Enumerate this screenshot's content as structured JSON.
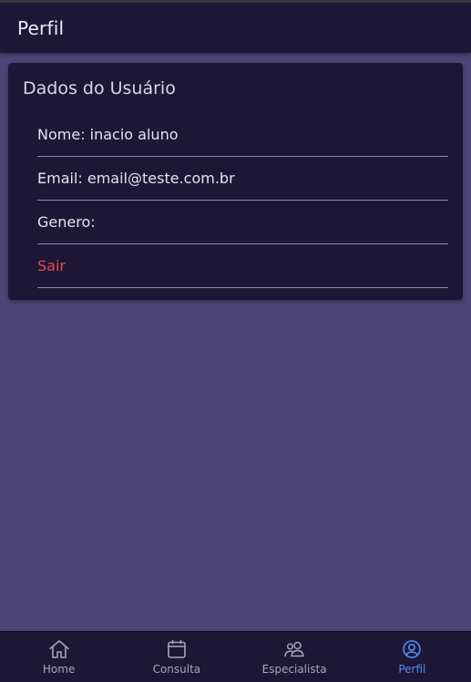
{
  "header": {
    "title": "Perfil"
  },
  "card": {
    "title": "Dados do Usuário",
    "items": [
      {
        "label": "Nome: inacio aluno"
      },
      {
        "label": "Email: email@teste.com.br"
      },
      {
        "label": "Genero:"
      },
      {
        "label": "Sair"
      }
    ]
  },
  "tabs": [
    {
      "label": "Home",
      "icon": "home-icon"
    },
    {
      "label": "Consulta",
      "icon": "calendar-icon"
    },
    {
      "label": "Especialista",
      "icon": "people-icon"
    },
    {
      "label": "Perfil",
      "icon": "person-circle-icon",
      "active": true
    }
  ],
  "colors": {
    "background": "#4c4576",
    "surface": "#1d1735",
    "active_tab": "#4d8dff",
    "danger": "#eb445a"
  }
}
